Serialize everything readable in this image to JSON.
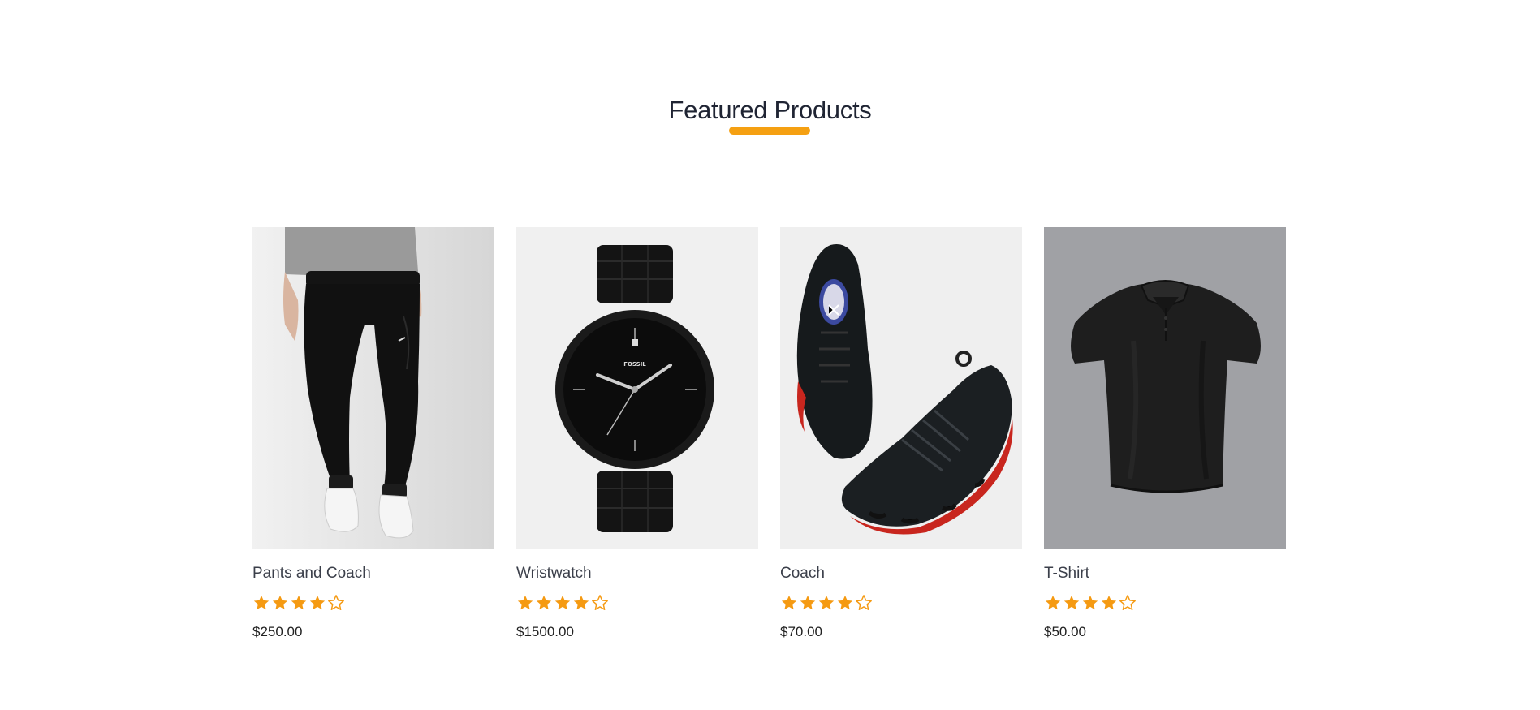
{
  "section": {
    "title": "Featured Products"
  },
  "colors": {
    "accent": "#f5a012",
    "title": "#1f2433",
    "star": "#f59a12"
  },
  "products": [
    {
      "name": "Pants and Coach",
      "price": "$250.00",
      "rating": 4,
      "rating_max": 5,
      "image_icon": "black-jogger-pants-image"
    },
    {
      "name": "Wristwatch",
      "price": "$1500.00",
      "rating": 4,
      "rating_max": 5,
      "image_icon": "black-wristwatch-image",
      "image_text": "FOSSIL"
    },
    {
      "name": "Coach",
      "price": "$70.00",
      "rating": 4,
      "rating_max": 5,
      "image_icon": "black-sneakers-image"
    },
    {
      "name": "T-Shirt",
      "price": "$50.00",
      "rating": 4,
      "rating_max": 5,
      "image_icon": "black-polo-shirt-image"
    }
  ]
}
